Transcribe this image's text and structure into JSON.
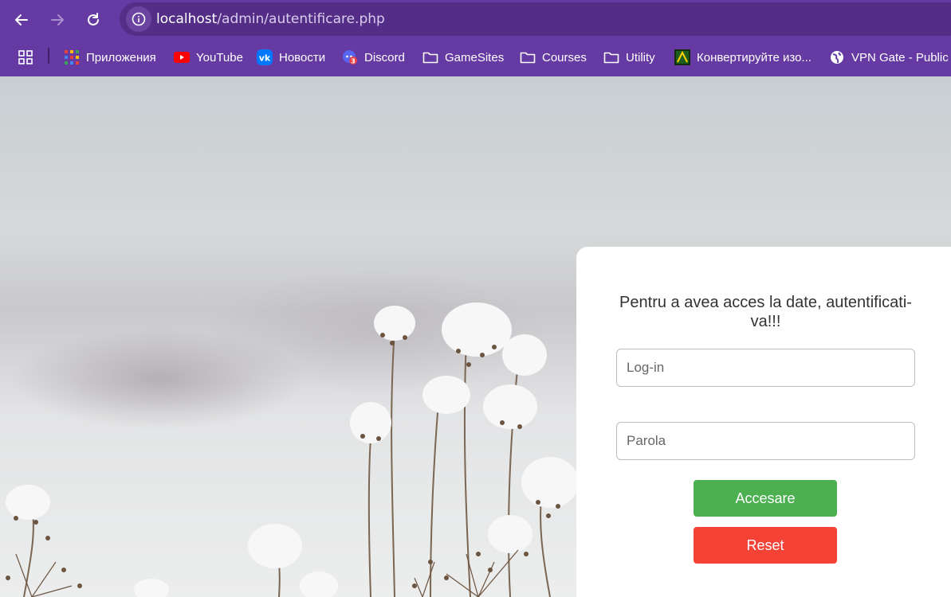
{
  "browser": {
    "url_host": "localhost",
    "url_path": "/admin/autentificare.php"
  },
  "bookmarks": [
    {
      "label": "Приложения",
      "icon": "apps-grid-icon"
    },
    {
      "label": "YouTube",
      "icon": "youtube-icon"
    },
    {
      "label": "Новости",
      "icon": "vk-icon"
    },
    {
      "label": "Discord",
      "icon": "discord-icon",
      "badge": "3"
    },
    {
      "label": "GameSites",
      "icon": "folder-icon"
    },
    {
      "label": "Courses",
      "icon": "folder-icon"
    },
    {
      "label": "Utility",
      "icon": "folder-icon"
    },
    {
      "label": "Конвертируйте изо...",
      "icon": "converter-icon"
    },
    {
      "label": "VPN Gate - Public F",
      "icon": "globe-icon"
    }
  ],
  "login": {
    "prompt": "Pentru a avea acces la date, autentificati-va!!!",
    "login_placeholder": "Log-in",
    "password_placeholder": "Parola",
    "submit_label": "Accesare",
    "reset_label": "Reset"
  },
  "colors": {
    "chrome": "#653aa3",
    "omnibox": "#532d86",
    "submit": "#4caf50",
    "reset": "#f44336"
  }
}
